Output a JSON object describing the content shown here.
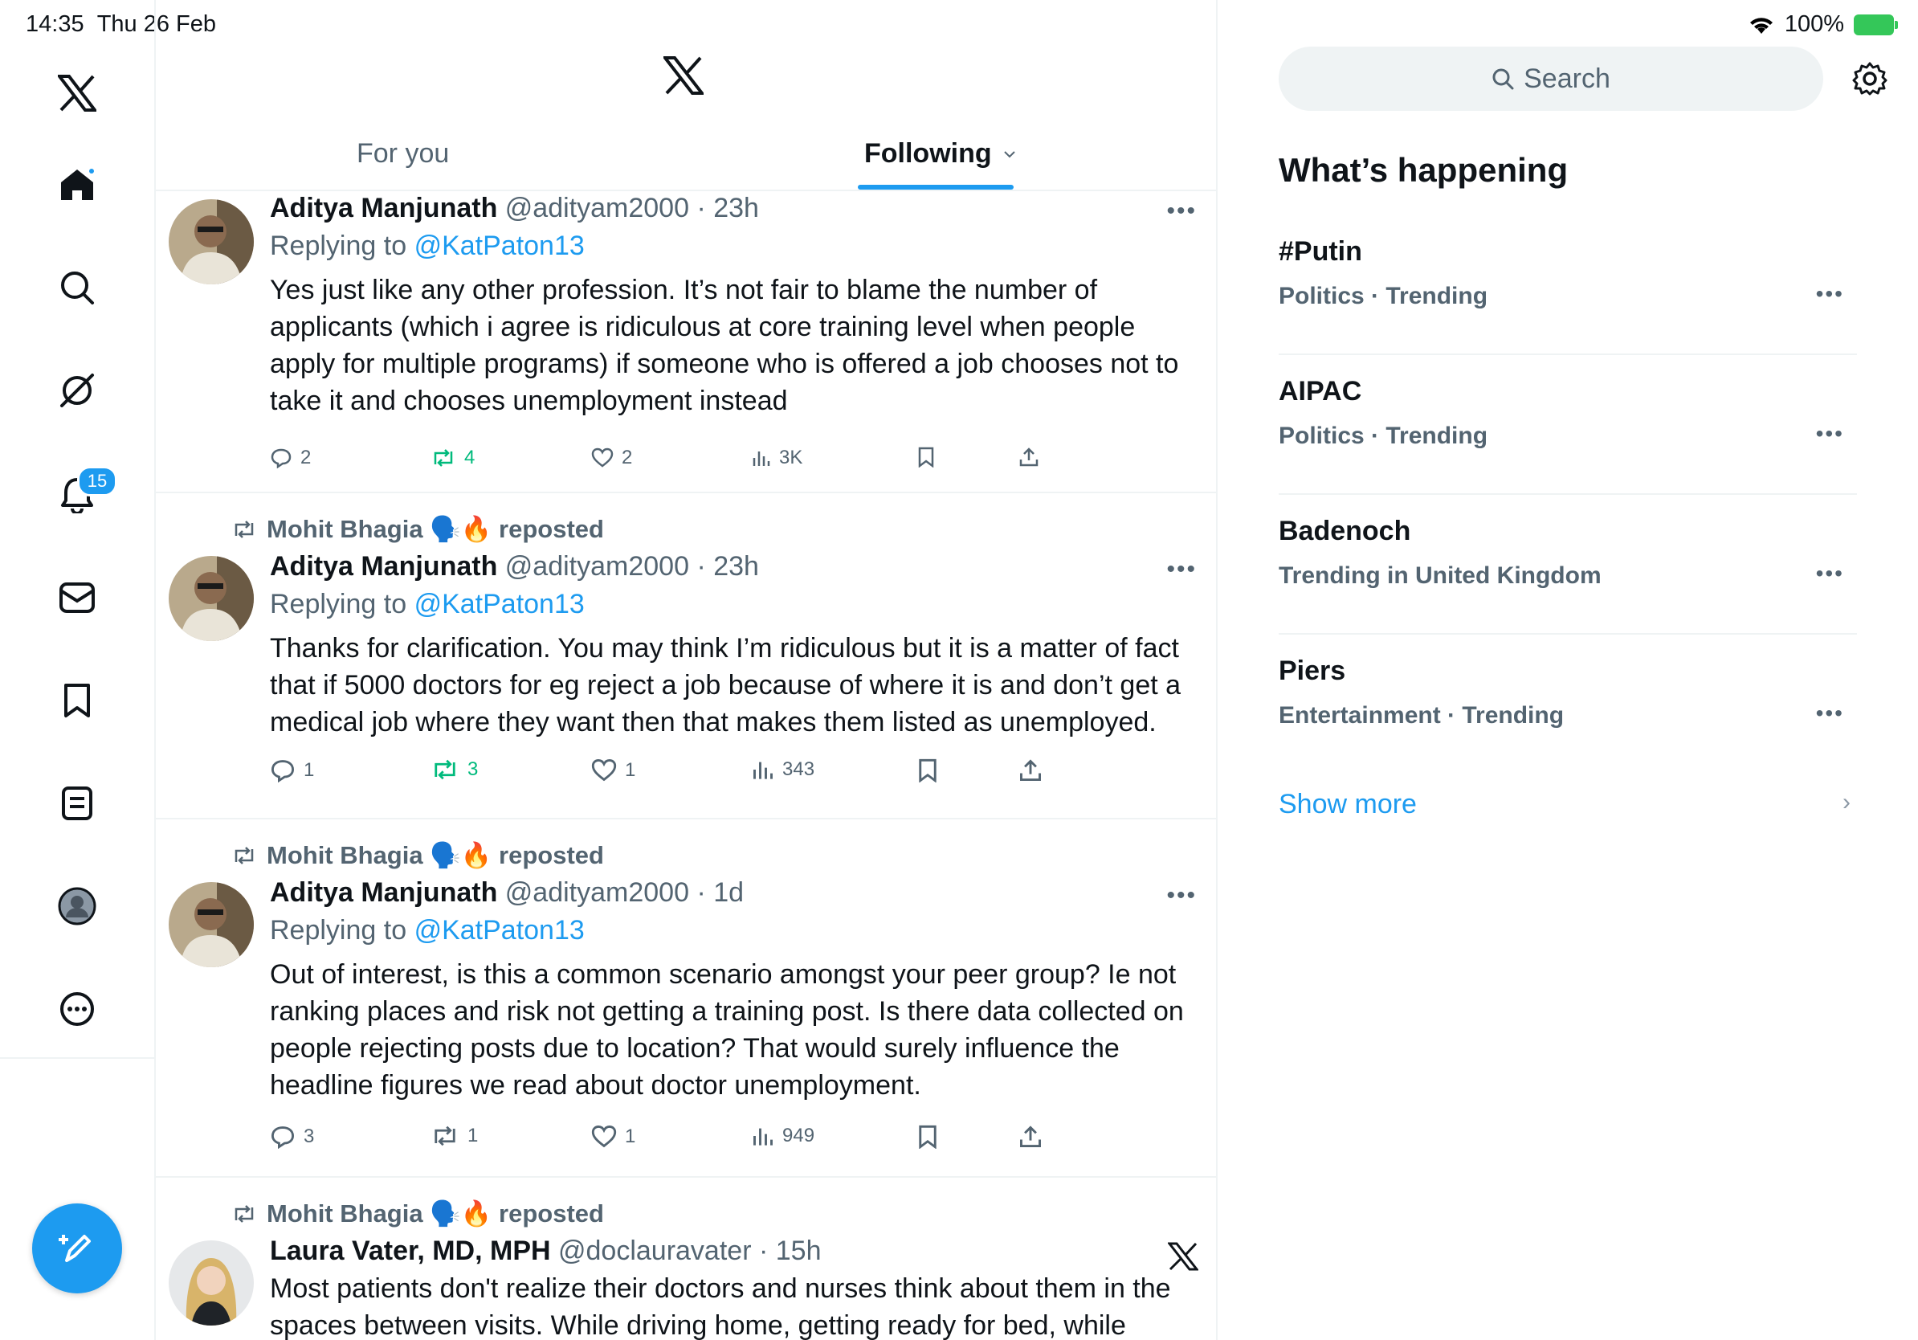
{
  "status_bar": {
    "time": "14:35",
    "date": "Thu 26 Feb",
    "battery": "100%"
  },
  "nav": {
    "items": [
      {
        "name": "x-logo-icon"
      },
      {
        "name": "home-icon"
      },
      {
        "name": "search-icon"
      },
      {
        "name": "grok-icon"
      },
      {
        "name": "notifications-icon"
      },
      {
        "name": "messages-icon"
      },
      {
        "name": "bookmarks-icon"
      },
      {
        "name": "lists-icon"
      },
      {
        "name": "profile-icon"
      },
      {
        "name": "more-icon"
      }
    ],
    "notification_count": "15"
  },
  "tabs": {
    "for_you": "For you",
    "following": "Following"
  },
  "tweets": [
    {
      "name": "Aditya Manjunath",
      "handle": "@adityam2000",
      "time": "23h",
      "replying_label": "Replying to",
      "replying_to": "@KatPaton13",
      "body": "Yes just like any other profession. It’s not fair to blame the number of applicants (which i agree is ridiculous at core training level when people apply for multiple programs) if someone who is offered a job chooses not to take it and chooses unemployment instead",
      "replies": "2",
      "reposts": "4",
      "likes": "2",
      "views": "3K"
    },
    {
      "reposter": "Mohit Bhagia 🗣️🔥 reposted",
      "name": "Aditya Manjunath",
      "handle": "@adityam2000",
      "time": "23h",
      "replying_label": "Replying to",
      "replying_to": "@KatPaton13",
      "body": "Thanks for clarification. You may think I’m ridiculous but it is a matter of fact that if 5000 doctors for eg reject a job because of where it is and don’t get a medical job where they want then that makes them listed as unemployed.",
      "replies": "1",
      "reposts": "3",
      "likes": "1",
      "views": "343"
    },
    {
      "reposter": "Mohit Bhagia 🗣️🔥 reposted",
      "name": "Aditya Manjunath",
      "handle": "@adityam2000",
      "time": "1d",
      "replying_label": "Replying to",
      "replying_to": "@KatPaton13",
      "body": "Out of interest, is this a common scenario amongst your peer group? Ie not ranking places and risk not getting a training post. Is there data collected on people rejecting posts due to location? That would surely influence the headline figures we read about doctor unemployment.",
      "replies": "3",
      "reposts": "1",
      "likes": "1",
      "views": "949"
    },
    {
      "reposter": "Mohit Bhagia 🗣️🔥 reposted",
      "name": "Laura Vater, MD, MPH",
      "handle": "@doclauravater",
      "time": "15h",
      "body": "Most patients don't realize their doctors and nurses think about them in the spaces between visits. While driving home, getting ready for bed, while"
    }
  ],
  "right": {
    "search_placeholder": "Search",
    "section_title": "What’s happening",
    "trends": [
      {
        "title": "#Putin",
        "meta": "Politics · Trending"
      },
      {
        "title": "AIPAC",
        "meta": "Politics · Trending"
      },
      {
        "title": "Badenoch",
        "meta": "Trending in United Kingdom"
      },
      {
        "title": "Piers",
        "meta": "Entertainment · Trending"
      }
    ],
    "show_more": "Show more"
  },
  "colors": {
    "accent": "#1d9bf0",
    "repost_green": "#00ba7c",
    "secondary_text": "#536471",
    "border": "#eff3f4"
  }
}
